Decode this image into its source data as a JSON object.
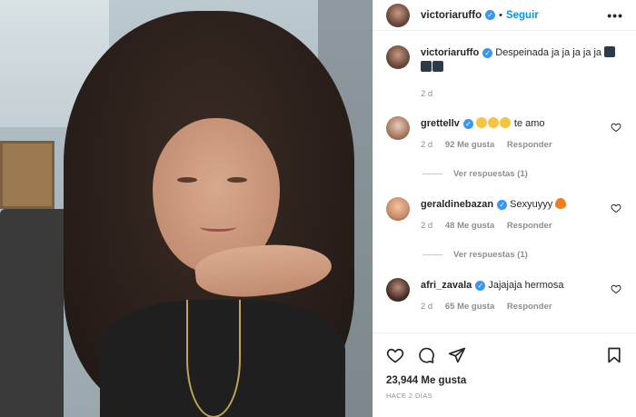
{
  "post": {
    "author": "victoriaruffo",
    "follow_label": "Seguir",
    "separator": "•",
    "more": "•••",
    "caption_author": "victoriaruffo",
    "caption_text": "Despeinada ja ja ja ja ja",
    "caption_time": "2 d"
  },
  "comments": [
    {
      "user": "grettellv",
      "text": "te amo",
      "emoji_count": 3,
      "time": "2 d",
      "likes": "92 Me gusta",
      "reply": "Responder",
      "replies": "Ver respuestas (1)"
    },
    {
      "user": "geraldinebazan",
      "text": "Sexyuyyy",
      "time": "2 d",
      "likes": "48 Me gusta",
      "reply": "Responder",
      "replies": "Ver respuestas (1)"
    },
    {
      "user": "afri_zavala",
      "text": "Jajajaja hermosa",
      "time": "2 d",
      "likes": "65 Me gusta",
      "reply": "Responder"
    }
  ],
  "footer": {
    "likes": "23,944 Me gusta",
    "ago": "HACE 2 DÍAS"
  },
  "colors": {
    "accent": "#0095f6",
    "verified": "#3897f0",
    "muted": "#8e8e8e"
  }
}
